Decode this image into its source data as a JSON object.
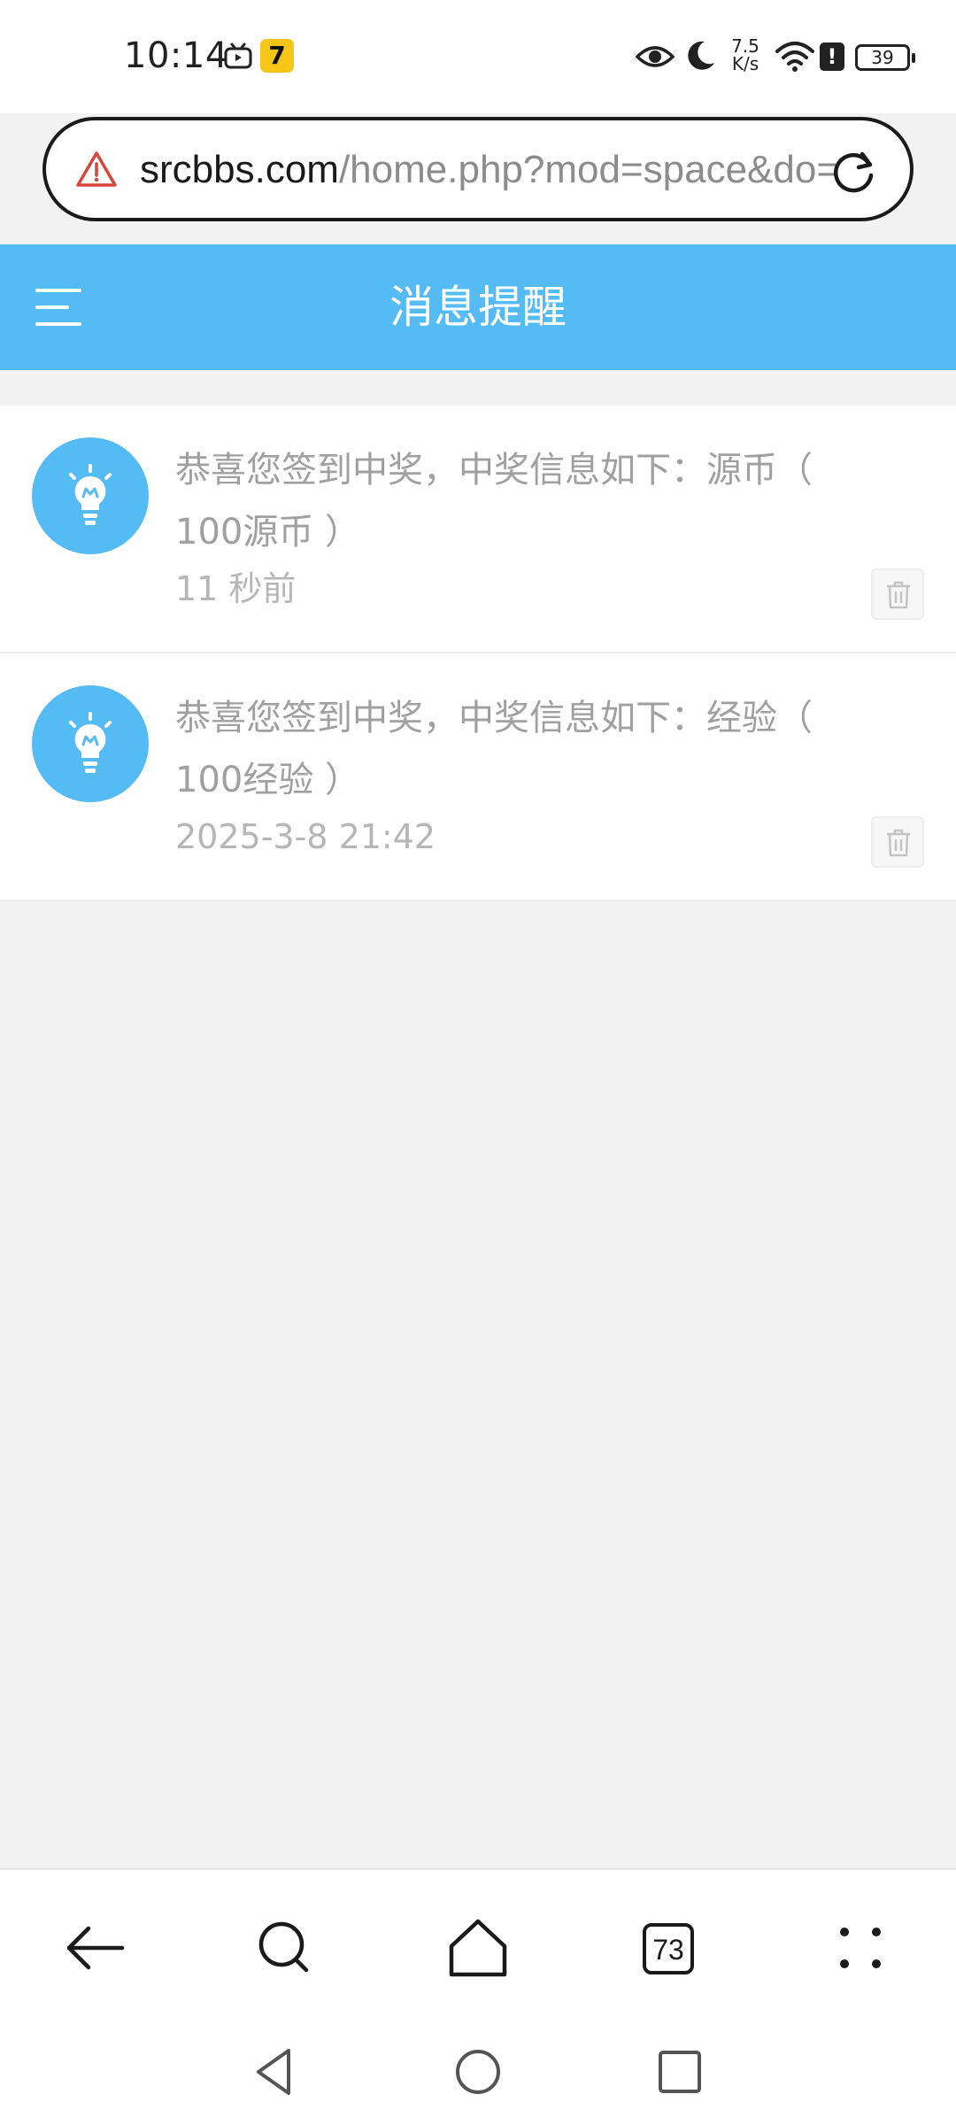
{
  "status_bar": {
    "time": "10:14",
    "app_badge": "7",
    "net_speed_value": "7.5",
    "net_speed_unit": "K/s",
    "alert": "!",
    "battery": "39",
    "icons": [
      "tv-icon",
      "app-icon",
      "eye-icon",
      "moon-icon",
      "wifi-icon",
      "alert-icon",
      "battery-icon"
    ]
  },
  "url_bar": {
    "host": "srcbbs.com",
    "path": "/home.php?mod=space&do=notice",
    "warning_color": "#d9453a"
  },
  "header": {
    "title": "消息提醒",
    "background": "#55bbf5"
  },
  "notices": [
    {
      "text": "恭喜您签到中奖，中奖信息如下：源币（ 100源币 ）",
      "time": "11 秒前"
    },
    {
      "text": "恭喜您签到中奖，中奖信息如下：经验（ 100经验 ）",
      "time": "2025-3-8 21:42"
    }
  ],
  "toolbar": {
    "tab_count": "73"
  }
}
